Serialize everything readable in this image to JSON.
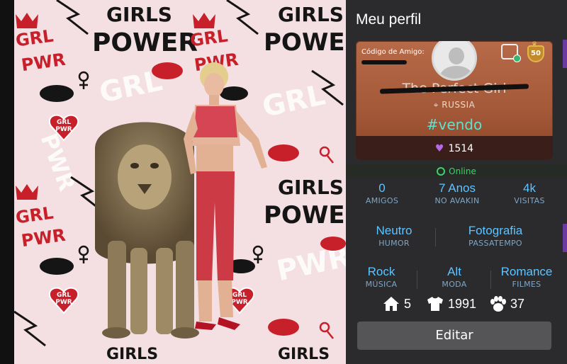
{
  "wallpaper": {
    "words": [
      "GIRLS",
      "POWER",
      "GRL",
      "PWR"
    ],
    "heart_text": [
      "GRL",
      "PWR"
    ]
  },
  "profile": {
    "title": "Meu perfil",
    "friend_code_label": "Código de Amigo:",
    "username": "The Perfect Girl",
    "location": "RUSSIA",
    "tagline": "#vendo",
    "likes": "1514",
    "level": "50",
    "status": "Online"
  },
  "stats": {
    "row1": [
      {
        "value": "0",
        "label": "AMIGOS"
      },
      {
        "value": "7 Anos",
        "label": "NO AVAKIN"
      },
      {
        "value": "4k",
        "label": "VISITAS"
      }
    ],
    "row2": [
      {
        "value": "Neutro",
        "label": "HUMOR"
      },
      {
        "value": "Fotografia",
        "label": "PASSATEMPO"
      }
    ],
    "row3": [
      {
        "value": "Rock",
        "label": "MÚSICA"
      },
      {
        "value": "Alt",
        "label": "MODA"
      },
      {
        "value": "Romance",
        "label": "FILMES"
      }
    ]
  },
  "counts": {
    "homes": "5",
    "outfits": "1991",
    "pets": "37"
  },
  "actions": {
    "edit_label": "Editar"
  },
  "colors": {
    "panel_bg": "#2b2b2d",
    "card_bg": "#a35838",
    "accent_blue": "#5fc4ff",
    "tag_teal": "#5fe0d0",
    "online_green": "#3fd16c",
    "heart_purple": "#b46ae8",
    "side_strip": "#6b3aa0"
  },
  "icons": [
    "clock-icon",
    "heart-icon",
    "home-icon",
    "shirt-icon",
    "paw-icon",
    "location-pin-icon",
    "friend-add-icon",
    "level-badge-icon"
  ]
}
